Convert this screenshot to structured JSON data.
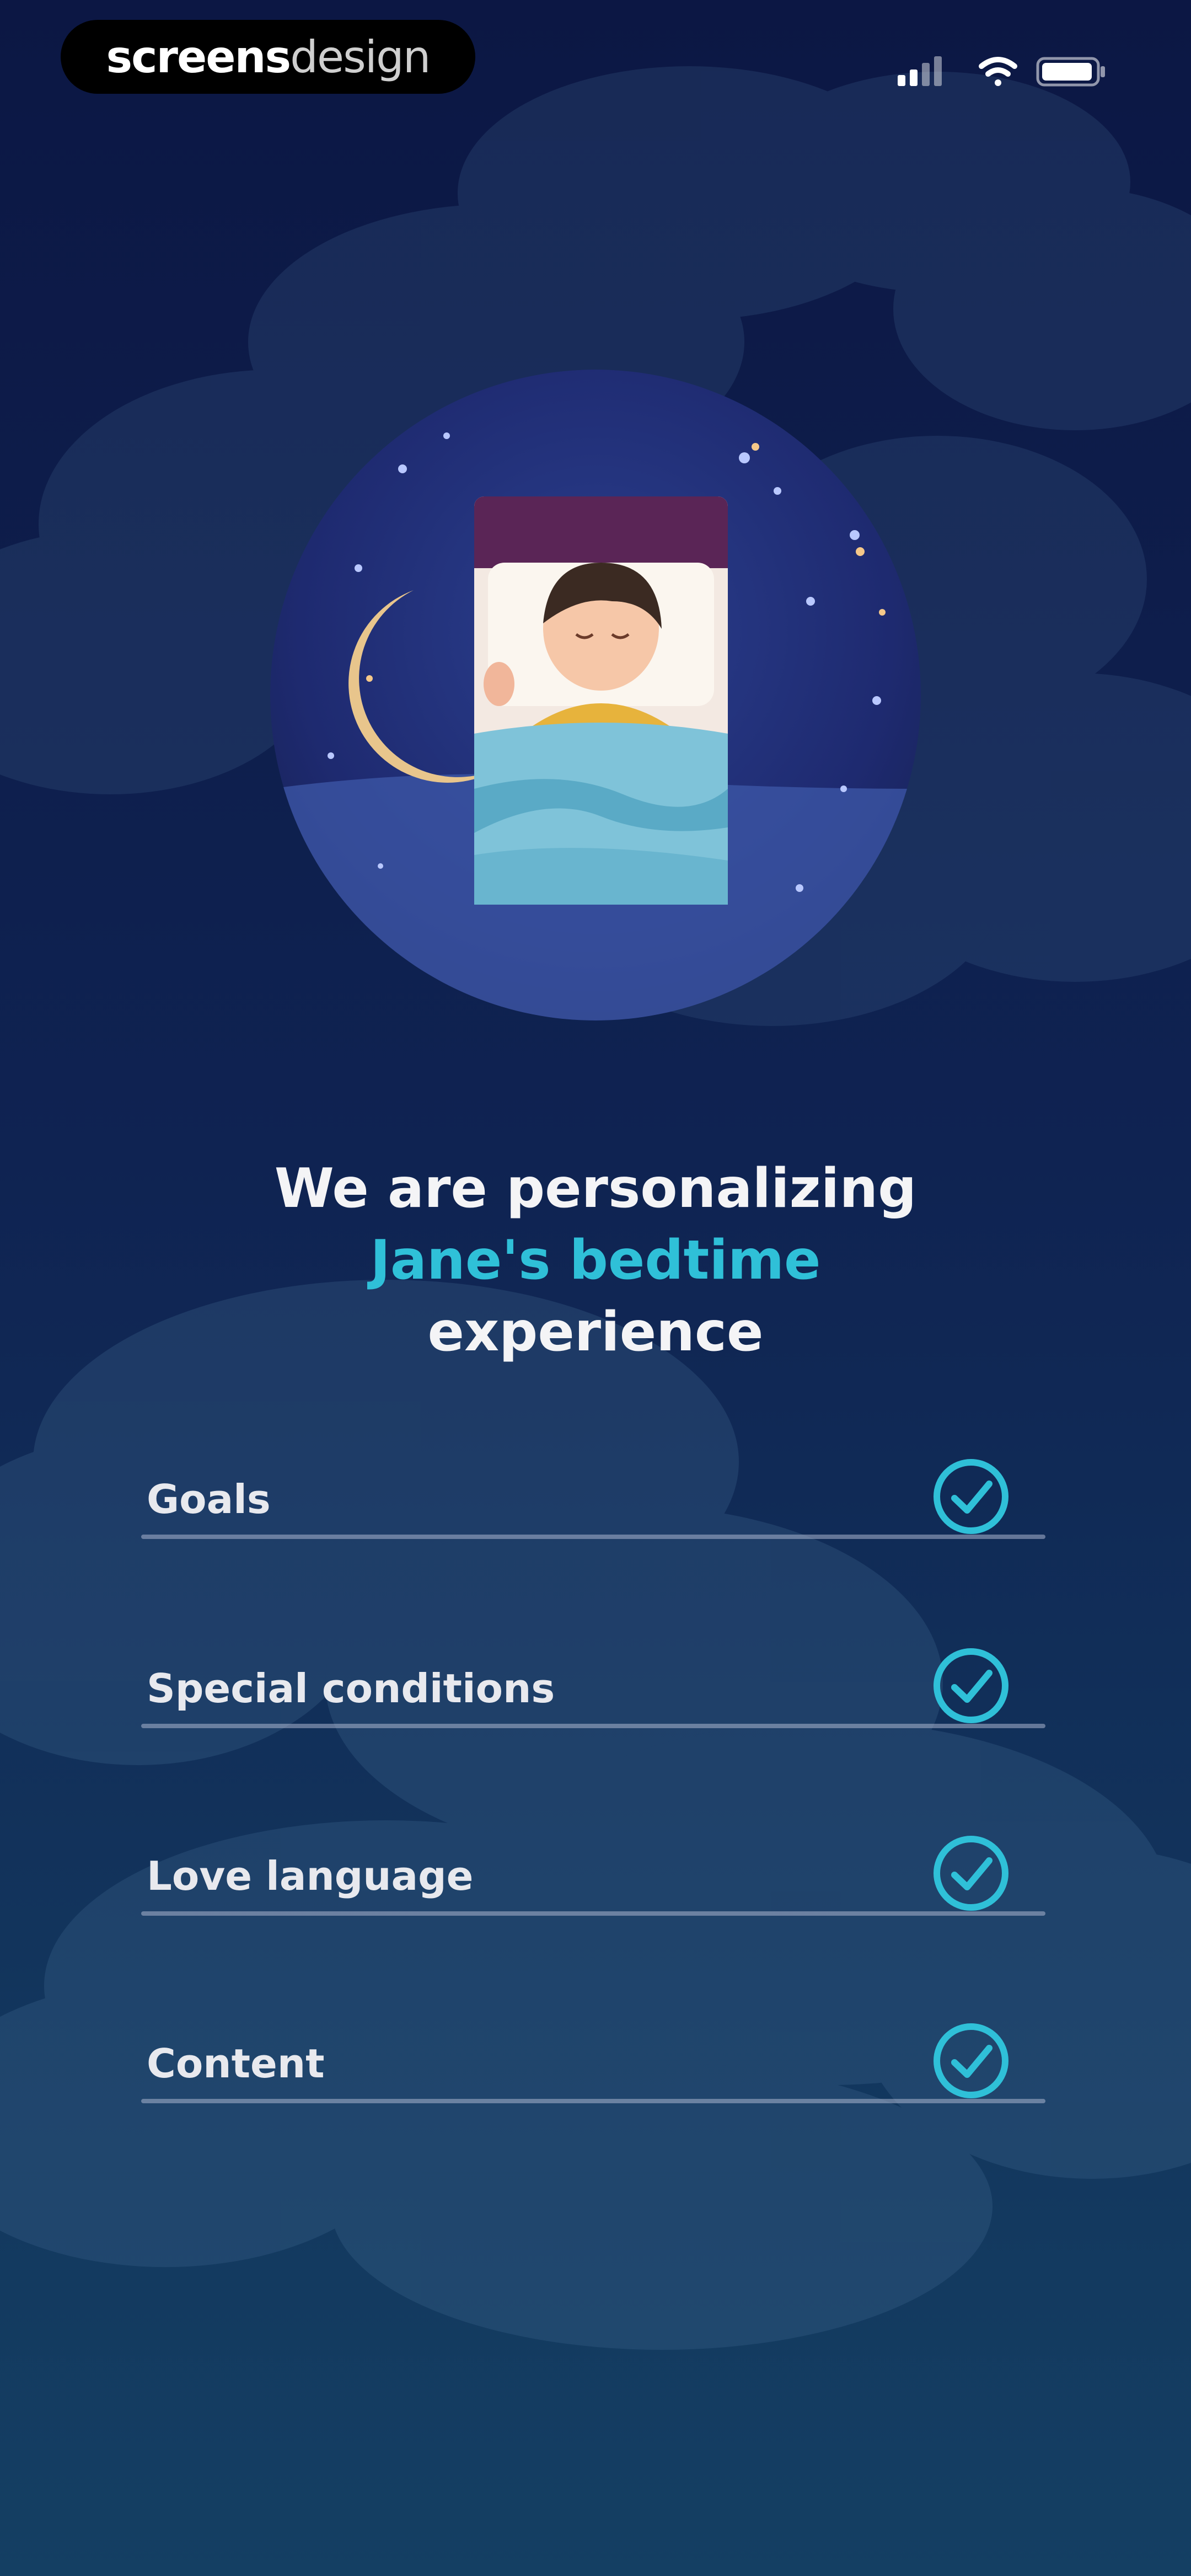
{
  "status_bar": {
    "brand_part1": "screens",
    "brand_part2": "design"
  },
  "header": {
    "title_line1": "We are personalizing",
    "title_highlight": "Jane's bedtime",
    "title_line3": "experience"
  },
  "checklist": {
    "items": [
      {
        "label": "Goals",
        "checked": true
      },
      {
        "label": "Special conditions",
        "checked": true
      },
      {
        "label": "Love language",
        "checked": true
      },
      {
        "label": "Content",
        "checked": true
      }
    ]
  },
  "colors": {
    "accent": "#2fc0d8",
    "background_top": "#0c1744",
    "background_bottom": "#143f63"
  },
  "icons": [
    "signal-icon",
    "wifi-icon",
    "battery-icon",
    "check-circle-icon"
  ]
}
